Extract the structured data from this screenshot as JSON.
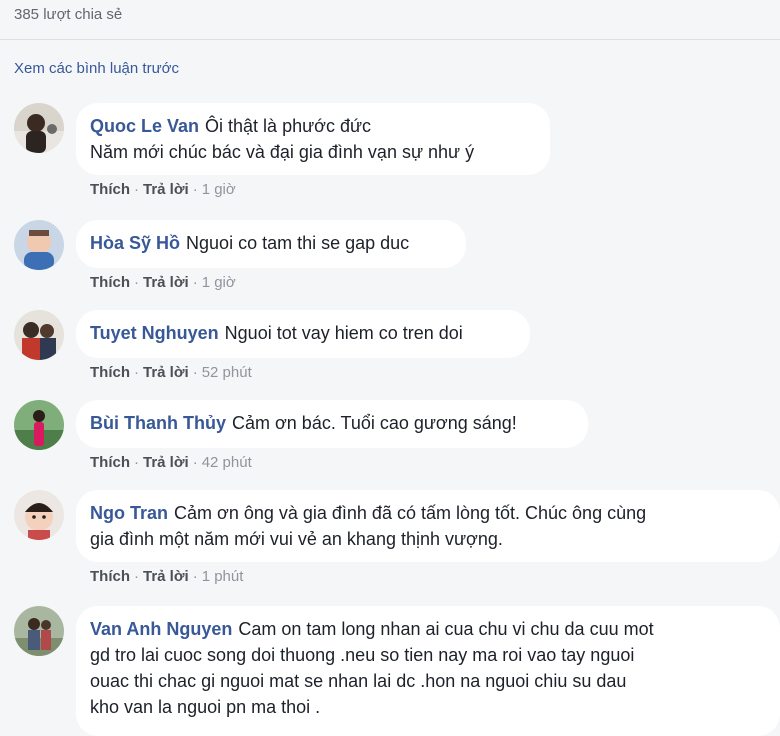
{
  "shares": "385 lượt chia sẻ",
  "view_previous": "Xem các bình luận trước",
  "action_labels": {
    "like": "Thích",
    "reply": "Trả lời",
    "separator": "·"
  },
  "comments": [
    {
      "author": "Quoc Le Van",
      "text_lines": [
        "Ôi thật là phước đức",
        "Năm mới chúc bác và đại gia đình vạn sự như ý"
      ],
      "time": "1 giờ"
    },
    {
      "author": "Hòa Sỹ Hồ",
      "text_lines": [
        "Nguoi co tam thi se gap duc"
      ],
      "time": "1 giờ"
    },
    {
      "author": "Tuyet Nghuyen",
      "text_lines": [
        "Nguoi tot vay hiem co tren doi"
      ],
      "time": "52 phút"
    },
    {
      "author": "Bùi Thanh Thủy",
      "text_lines": [
        "Cảm ơn bác. Tuổi cao gương sáng!"
      ],
      "time": "42 phút"
    },
    {
      "author": "Ngo Tran",
      "text_lines": [
        "Cảm ơn ông và gia đình đã có tấm lòng tốt. Chúc ông cùng",
        "gia đình một năm mới vui vẻ an khang thịnh vượng."
      ],
      "time": "1 phút"
    },
    {
      "author": "Van Anh Nguyen",
      "text_lines": [
        "Cam on tam long nhan ai cua chu vi chu da cuu mot",
        "gd tro lai cuoc song doi thuong .neu so tien nay ma roi vao tay nguoi",
        "ouac thi chac gi nguoi mat se nhan lai dc .hon na nguoi chiu su dau",
        "kho van la nguoi pn ma thoi ."
      ],
      "time": ""
    }
  ]
}
